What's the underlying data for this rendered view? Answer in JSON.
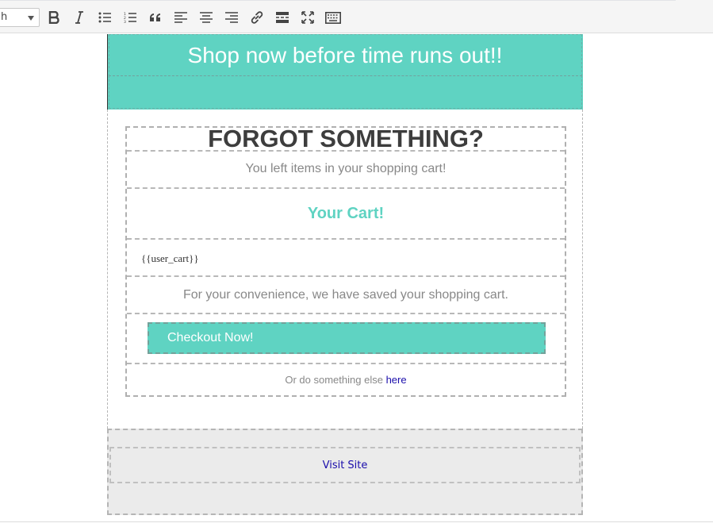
{
  "toolbar": {
    "format_select_value": "h",
    "buttons": [
      {
        "name": "bold-icon",
        "title": "Bold"
      },
      {
        "name": "italic-icon",
        "title": "Italic"
      },
      {
        "name": "bulleted-list-icon",
        "title": "Bulleted list"
      },
      {
        "name": "numbered-list-icon",
        "title": "Numbered list"
      },
      {
        "name": "blockquote-icon",
        "title": "Blockquote"
      },
      {
        "name": "align-left-icon",
        "title": "Align left"
      },
      {
        "name": "align-center-icon",
        "title": "Align center"
      },
      {
        "name": "align-right-icon",
        "title": "Align right"
      },
      {
        "name": "link-icon",
        "title": "Insert/edit link"
      },
      {
        "name": "read-more-icon",
        "title": "Insert Read More tag"
      },
      {
        "name": "fullscreen-icon",
        "title": "Fullscreen"
      },
      {
        "name": "keyboard-icon",
        "title": "Toolbar Toggle"
      }
    ]
  },
  "email": {
    "hero_title": "Shop now before time runs out!!",
    "headline": "FORGOT SOMETHING?",
    "subhead": "You left items in your shopping cart!",
    "cart_title": "Your Cart!",
    "cart_placeholder": "{{user_cart}}",
    "convenience_text": "For your convenience, we have saved your shopping cart.",
    "checkout_label": "Checkout Now!",
    "alt_prefix": "Or do something else",
    "alt_link": "here",
    "footer_link": "Visit Site"
  },
  "colors": {
    "accent": "#5fd3c2",
    "headline": "#3d3d3d",
    "muted_text": "#888888",
    "link": "#1a0dab",
    "footer_bg": "#ebebeb"
  }
}
